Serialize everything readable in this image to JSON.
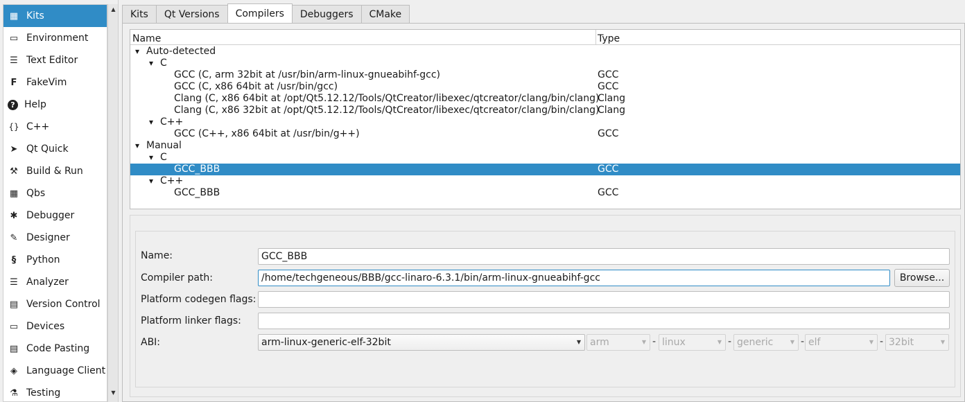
{
  "sidebar": {
    "items": [
      {
        "label": "Kits",
        "icon": "kits-icon"
      },
      {
        "label": "Environment",
        "icon": "monitor-icon"
      },
      {
        "label": "Text Editor",
        "icon": "text-editor-icon"
      },
      {
        "label": "FakeVim",
        "icon": "fakevim-icon"
      },
      {
        "label": "Help",
        "icon": "help-icon"
      },
      {
        "label": "C++",
        "icon": "braces-icon"
      },
      {
        "label": "Qt Quick",
        "icon": "qt-quick-icon"
      },
      {
        "label": "Build & Run",
        "icon": "hammer-icon"
      },
      {
        "label": "Qbs",
        "icon": "qbs-icon"
      },
      {
        "label": "Debugger",
        "icon": "bug-icon"
      },
      {
        "label": "Designer",
        "icon": "pencil-icon"
      },
      {
        "label": "Python",
        "icon": "python-icon"
      },
      {
        "label": "Analyzer",
        "icon": "analyzer-icon"
      },
      {
        "label": "Version Control",
        "icon": "version-control-icon"
      },
      {
        "label": "Devices",
        "icon": "devices-icon"
      },
      {
        "label": "Code Pasting",
        "icon": "clipboard-icon"
      },
      {
        "label": "Language Client",
        "icon": "language-client-icon"
      },
      {
        "label": "Testing",
        "icon": "flask-icon"
      }
    ],
    "selected_index": 0
  },
  "tabs": [
    {
      "label": "Kits"
    },
    {
      "label": "Qt Versions"
    },
    {
      "label": "Compilers"
    },
    {
      "label": "Debuggers"
    },
    {
      "label": "CMake"
    }
  ],
  "active_tab": "Compilers",
  "tree": {
    "columns": {
      "name": "Name",
      "type": "Type"
    },
    "rows": [
      {
        "name": "Auto-detected",
        "type": "",
        "level": 0,
        "expandable": true
      },
      {
        "name": "C",
        "type": "",
        "level": 1,
        "expandable": true
      },
      {
        "name": "GCC (C, arm 32bit at /usr/bin/arm-linux-gnueabihf-gcc)",
        "type": "GCC",
        "level": 2,
        "expandable": false
      },
      {
        "name": "GCC (C, x86 64bit at /usr/bin/gcc)",
        "type": "GCC",
        "level": 2,
        "expandable": false
      },
      {
        "name": "Clang (C, x86 64bit at /opt/Qt5.12.12/Tools/QtCreator/libexec/qtcreator/clang/bin/clang)",
        "type": "Clang",
        "level": 2,
        "expandable": false
      },
      {
        "name": "Clang (C, x86 32bit at /opt/Qt5.12.12/Tools/QtCreator/libexec/qtcreator/clang/bin/clang)",
        "type": "Clang",
        "level": 2,
        "expandable": false
      },
      {
        "name": "C++",
        "type": "",
        "level": 1,
        "expandable": true
      },
      {
        "name": "GCC (C++, x86 64bit at /usr/bin/g++)",
        "type": "GCC",
        "level": 2,
        "expandable": false
      },
      {
        "name": "Manual",
        "type": "",
        "level": 0,
        "expandable": true
      },
      {
        "name": "C",
        "type": "",
        "level": 1,
        "expandable": true
      },
      {
        "name": "GCC_BBB",
        "type": "GCC",
        "level": 2,
        "expandable": false,
        "selected": true
      },
      {
        "name": "C++",
        "type": "",
        "level": 1,
        "expandable": true
      },
      {
        "name": "GCC_BBB",
        "type": "GCC",
        "level": 2,
        "expandable": false
      }
    ]
  },
  "details": {
    "name_label": "Name:",
    "name_value": "GCC_BBB",
    "compiler_path_label": "Compiler path:",
    "compiler_path_value": "/home/techgeneous/BBB/gcc-linaro-6.3.1/bin/arm-linux-gnueabihf-gcc",
    "browse_label": "Browse...",
    "codegen_label": "Platform codegen flags:",
    "codegen_value": "",
    "linker_label": "Platform linker flags:",
    "linker_value": "",
    "abi_label": "ABI:",
    "abi_value": "arm-linux-generic-elf-32bit",
    "abi_parts": [
      "arm",
      "linux",
      "generic",
      "elf",
      "32bit"
    ],
    "abi_separator": "-"
  },
  "colors": {
    "selection": "#308cc6",
    "background": "#efefef"
  }
}
